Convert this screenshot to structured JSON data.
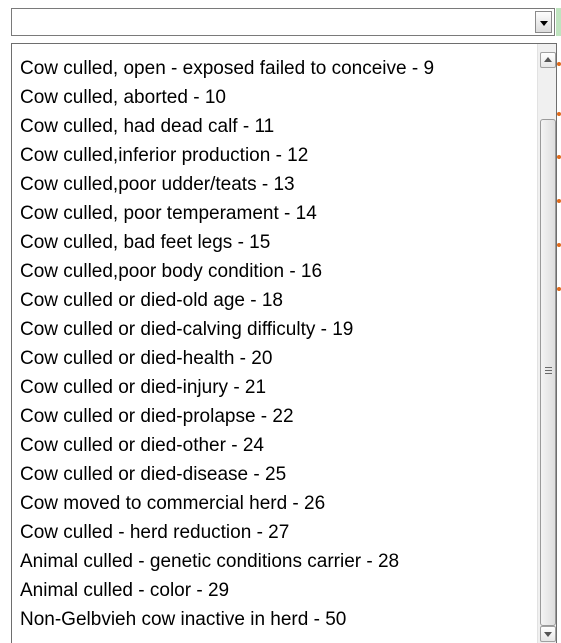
{
  "select": {
    "value": "",
    "dropdown_icon": "chevron-down-icon"
  },
  "options": [
    {
      "label": "Cow culled, open - exposed failed to conceive - 9"
    },
    {
      "label": "Cow culled, aborted - 10"
    },
    {
      "label": "Cow culled, had dead calf - 11"
    },
    {
      "label": "Cow culled,inferior production - 12"
    },
    {
      "label": "Cow culled,poor udder/teats - 13"
    },
    {
      "label": "Cow culled, poor temperament - 14"
    },
    {
      "label": "Cow culled, bad feet legs - 15"
    },
    {
      "label": "Cow culled,poor body condition - 16"
    },
    {
      "label": "Cow culled or died-old age - 18"
    },
    {
      "label": "Cow culled or died-calving difficulty - 19"
    },
    {
      "label": "Cow culled or died-health - 20"
    },
    {
      "label": "Cow culled or died-injury - 21"
    },
    {
      "label": "Cow culled or died-prolapse - 22"
    },
    {
      "label": "Cow culled or died-other - 24"
    },
    {
      "label": "Cow culled or died-disease - 25"
    },
    {
      "label": "Cow moved to commercial herd - 26"
    },
    {
      "label": "Cow culled - herd reduction - 27"
    },
    {
      "label": "Animal culled - genetic conditions carrier - 28"
    },
    {
      "label": "Animal culled - color - 29"
    },
    {
      "label": "Non-Gelbvieh cow inactive in herd - 50"
    }
  ],
  "scrollbar": {
    "position_fraction": 0.1,
    "visible_fraction": 0.88
  },
  "colors": {
    "accent_dots": "#e06a1a",
    "green_edge": "#bfe4bf"
  }
}
